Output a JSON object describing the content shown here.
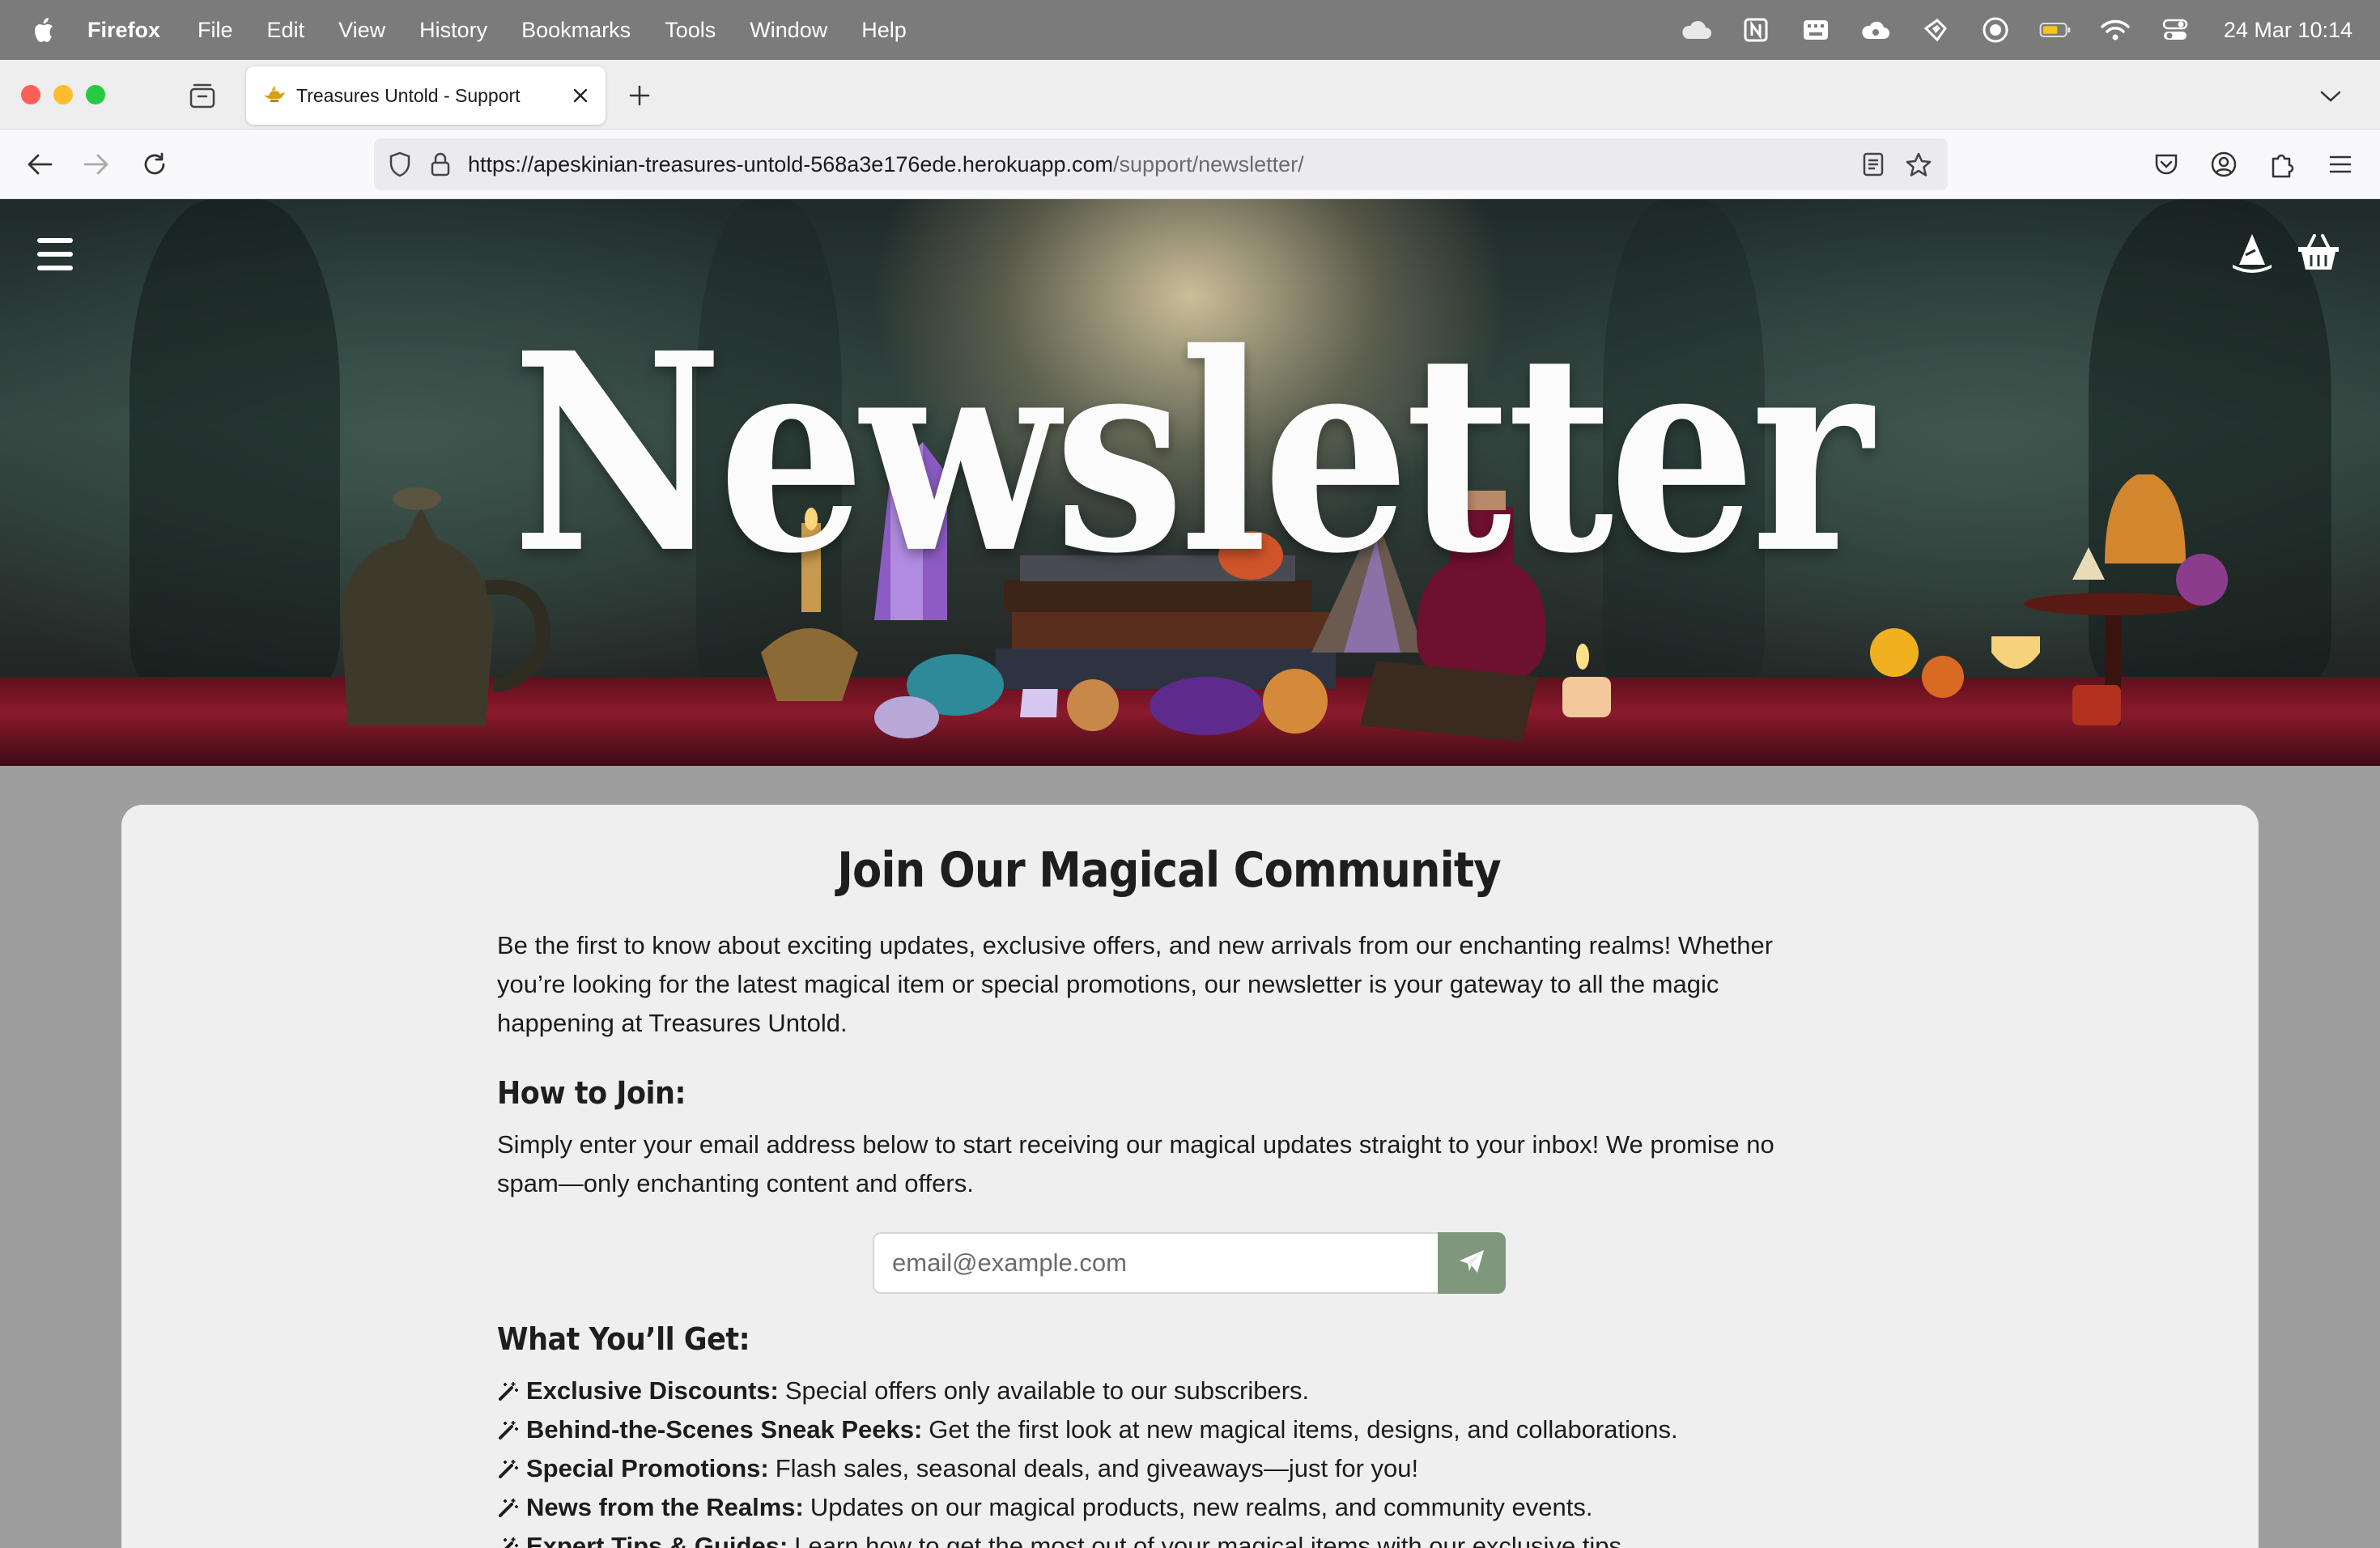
{
  "menubar": {
    "app_name": "Firefox",
    "items": [
      "File",
      "Edit",
      "View",
      "History",
      "Bookmarks",
      "Tools",
      "Window",
      "Help"
    ],
    "datetime": "24 Mar  10:14"
  },
  "browser": {
    "tab_title": "Treasures Untold - Support",
    "url_main": "https://apeskinian-treasures-untold-568a3e176ede.herokuapp.com",
    "url_path": "/support/newsletter/"
  },
  "hero": {
    "title": "Newsletter"
  },
  "content": {
    "heading": "Join Our Magical Community",
    "intro": "Be the first to know about exciting updates, exclusive offers, and new arrivals from our enchanting realms! Whether you’re looking for the latest magical item or special promotions, our newsletter is your gateway to all the magic happening at Treasures Untold.",
    "how_heading": "How to Join:",
    "how_text": "Simply enter your email address below to start receiving our magical updates straight to your inbox! We promise no spam—only enchanting content and offers.",
    "email_placeholder": "email@example.com",
    "get_heading": "What You’ll Get:",
    "benefits": [
      {
        "title": "Exclusive Discounts:",
        "text": "Special offers only available to our subscribers."
      },
      {
        "title": "Behind-the-Scenes Sneak Peeks:",
        "text": "Get the first look at new magical items, designs, and collaborations."
      },
      {
        "title": "Special Promotions:",
        "text": "Flash sales, seasonal deals, and giveaways—just for you!"
      },
      {
        "title": "News from the Realms:",
        "text": "Updates on our magical products, new realms, and community events."
      },
      {
        "title": "Expert Tips & Guides:",
        "text": "Learn how to get the most out of your magical items with our exclusive tips."
      }
    ]
  },
  "colors": {
    "send_button": "#7f977c",
    "card_bg": "#efefef",
    "menubar_bg": "#7b7b7b"
  },
  "icons": {
    "apple": "apple-icon",
    "hamburger": "hamburger-menu-icon",
    "account": "wizard-hat-icon",
    "cart": "basket-icon",
    "send": "paper-plane-icon",
    "benefit": "magic-wand-icon"
  }
}
